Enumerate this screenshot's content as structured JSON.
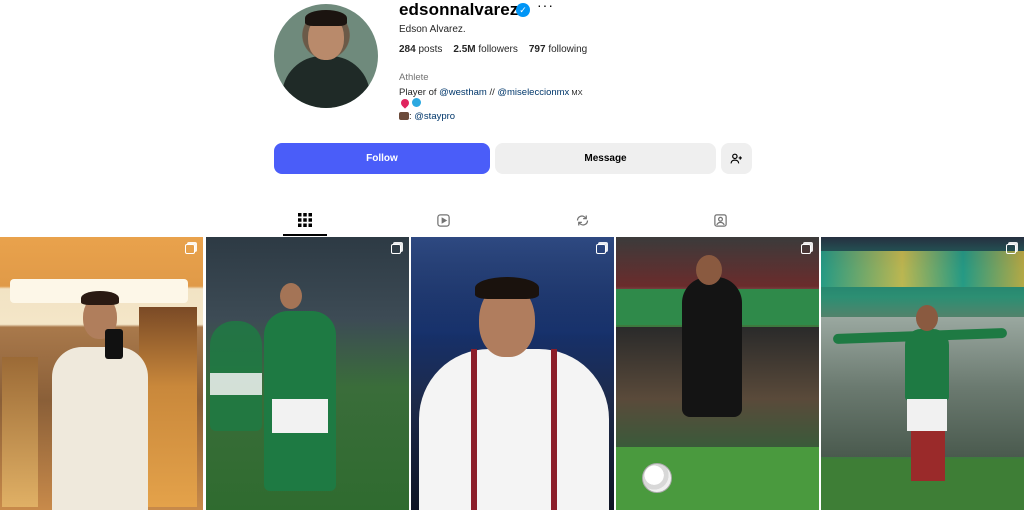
{
  "profile": {
    "username": "edsonnalvarez",
    "full_name": "Edson Alvarez.",
    "stats": {
      "posts_count": "284",
      "posts_label": "posts",
      "followers_count": "2.5M",
      "followers_label": "followers",
      "following_count": "797",
      "following_label": "following"
    },
    "category": "Athlete",
    "bio": {
      "line1_prefix": "Player of ",
      "mention1": "@westham",
      "separator": " // ",
      "mention2": "@miseleccionmx",
      "line1_suffix": " MX",
      "line3_prefix": ": ",
      "mention3": "@staypro"
    }
  },
  "actions": {
    "follow_label": "Follow",
    "message_label": "Message",
    "add_user_icon": "add-user-icon"
  },
  "tabs": [
    {
      "name": "posts",
      "icon": "grid-icon",
      "active": true
    },
    {
      "name": "reels",
      "icon": "reels-icon",
      "active": false
    },
    {
      "name": "reposts",
      "icon": "repost-icon",
      "active": false
    },
    {
      "name": "tagged",
      "icon": "tagged-icon",
      "active": false
    }
  ],
  "colors": {
    "follow_button": "#4a5df9",
    "message_button": "#efefef",
    "verified_badge": "#0095f6",
    "mention": "#00376b"
  }
}
